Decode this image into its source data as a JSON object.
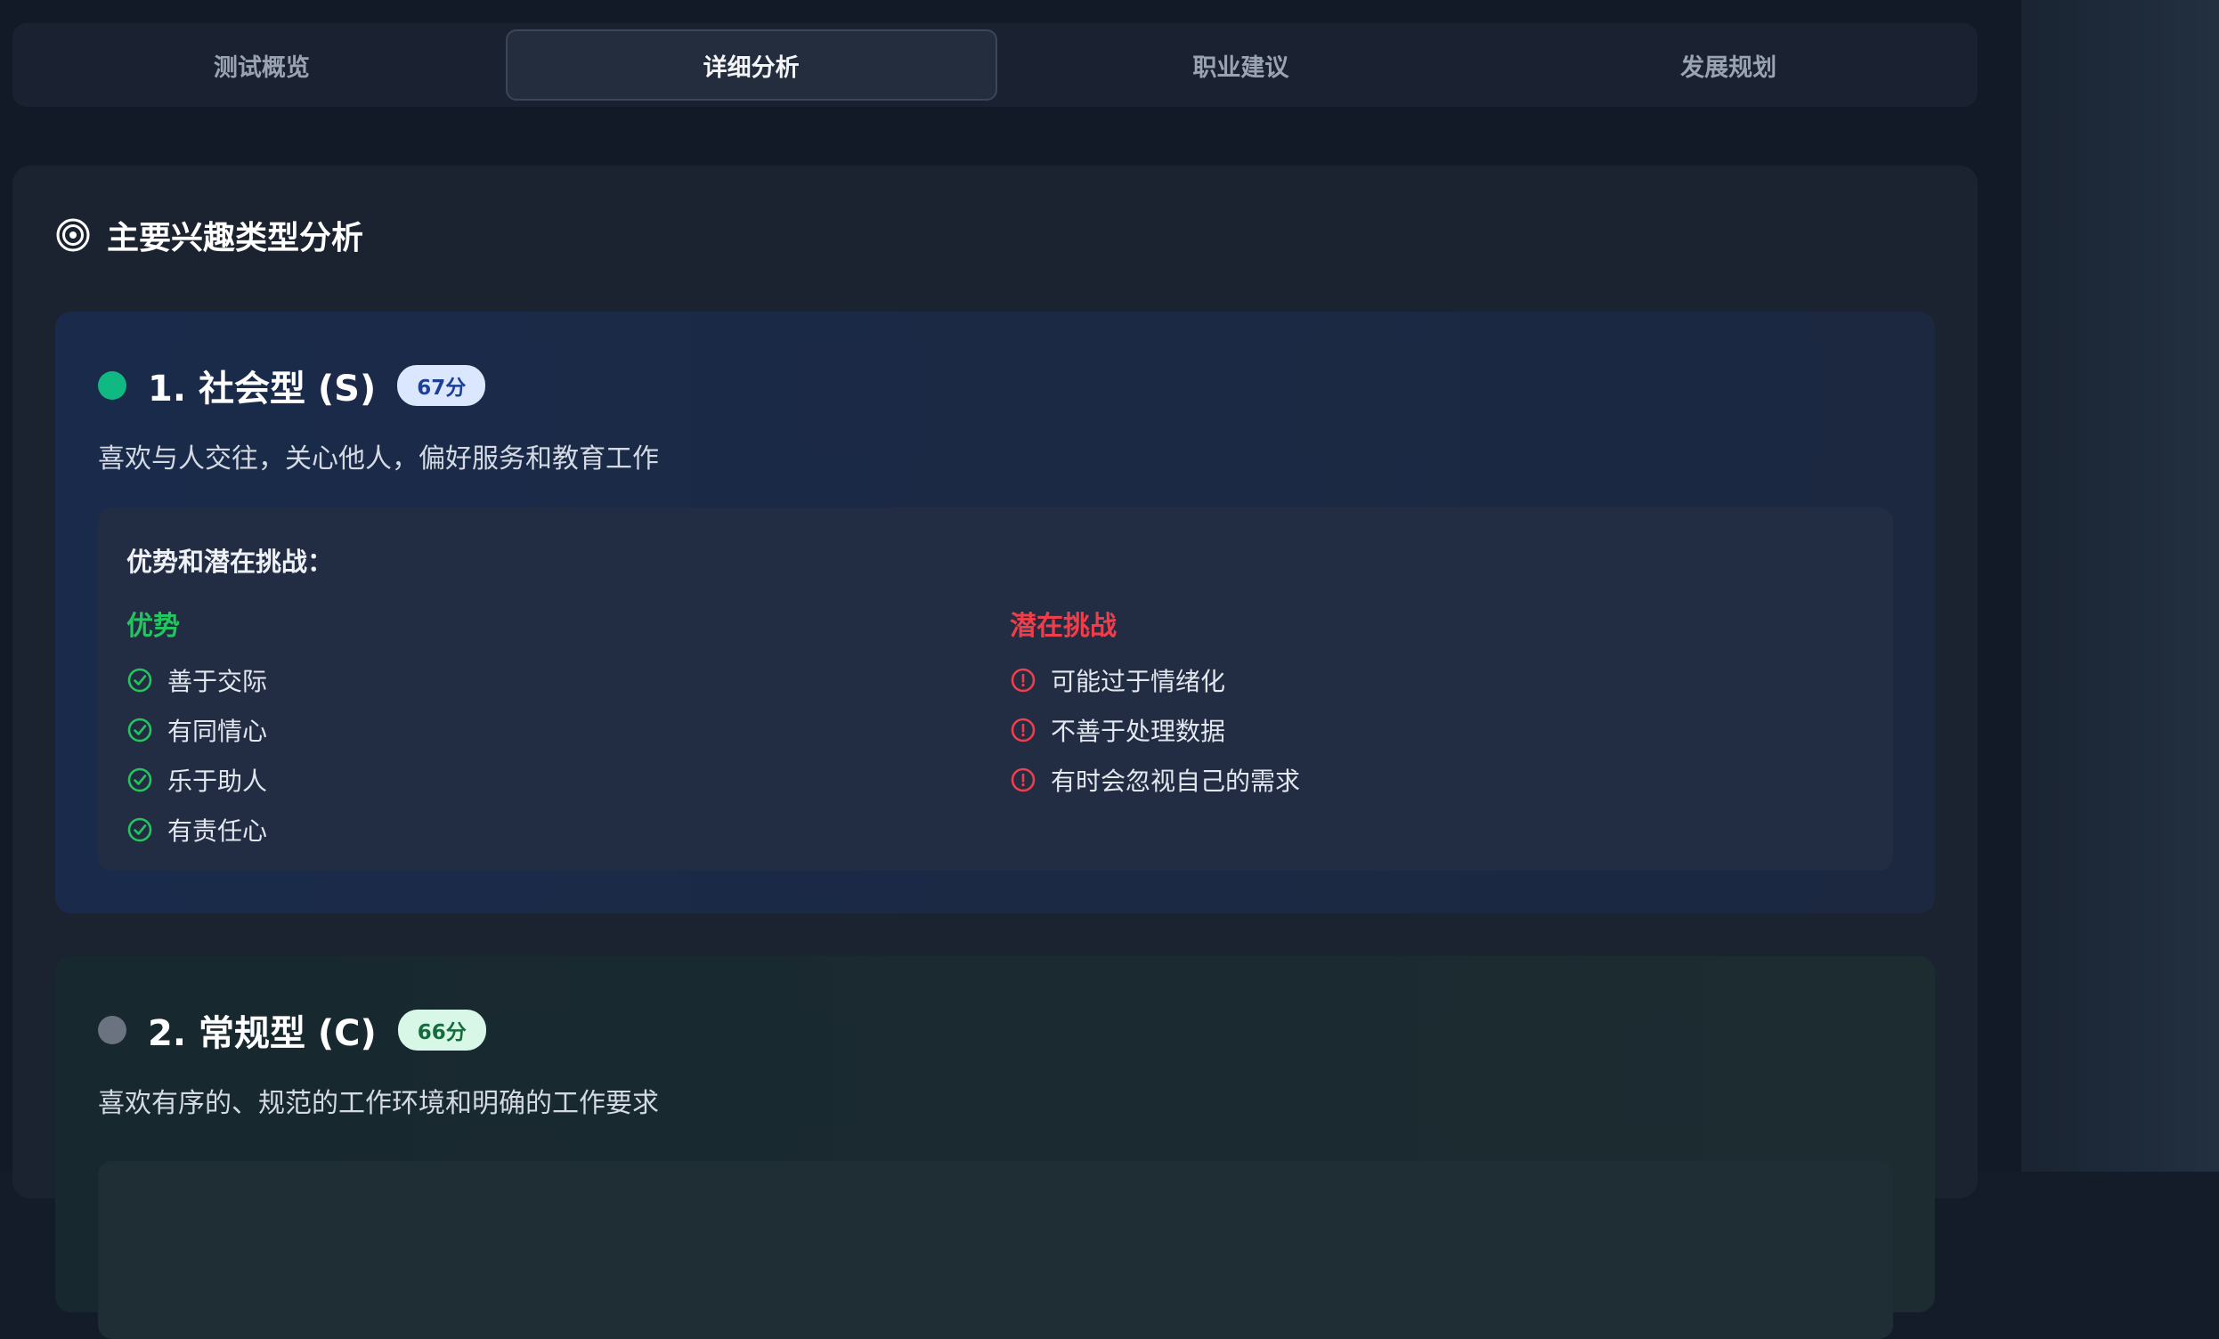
{
  "tabs": [
    {
      "label": "测试概览"
    },
    {
      "label": "详细分析"
    },
    {
      "label": "职业建议"
    },
    {
      "label": "发展规划"
    }
  ],
  "section": {
    "title": "主要兴趣类型分析",
    "icon": "target-icon"
  },
  "types": [
    {
      "title": "1. 社会型 (S)",
      "score": "67分",
      "dot_color": "#10b981",
      "description": "喜欢与人交往，关心他人，偏好服务和教育工作",
      "analysis_title": "优势和潜在挑战：",
      "strengths_title": "优势",
      "strengths": [
        "善于交际",
        "有同情心",
        "乐于助人",
        "有责任心"
      ],
      "challenges_title": "潜在挑战",
      "challenges": [
        "可能过于情绪化",
        "不善于处理数据",
        "有时会忽视自己的需求"
      ]
    },
    {
      "title": "2. 常规型 (C)",
      "score": "66分",
      "dot_color": "#6b7280",
      "description": "喜欢有序的、规范的工作环境和明确的工作要求"
    }
  ],
  "colors": {
    "strength": "#22c55e",
    "challenge": "#ef3e4a",
    "active_tab_border": "#3b4658"
  }
}
